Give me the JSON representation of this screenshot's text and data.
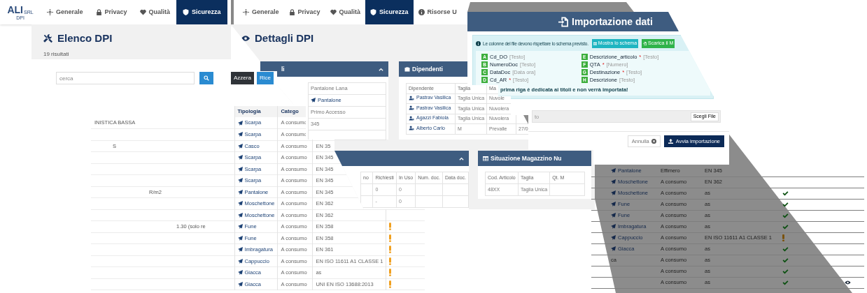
{
  "left_panel": {
    "logo": {
      "text": "ALI",
      "suffix": "SRL",
      "tagline": "DPI"
    },
    "tabs": [
      {
        "label": "Generale",
        "selected": false
      },
      {
        "label": "Privacy",
        "selected": false
      },
      {
        "label": "Qualità",
        "selected": false
      },
      {
        "label": "Sicurezza",
        "selected": true
      }
    ],
    "title": "Elenco DPI",
    "subtitle": "19 risultati",
    "search": {
      "placeholder": "cerca"
    },
    "buttons": [
      {
        "label": "Azzera",
        "kind": "dark"
      },
      {
        "label": "Rice",
        "kind": "primary"
      }
    ],
    "table": {
      "columns": [
        "Tipologia",
        "Catego"
      ],
      "rows": [
        {
          "column_1": "INISTICA BASSA",
          "tipologia": "Scarpa",
          "categoria": "A consumo"
        },
        {
          "tipologia": "Scarpa",
          "categoria": "A consumo"
        },
        {
          "column_1": "S",
          "tipologia": "Casco",
          "categoria": "A consumo",
          "norma": "EN 35"
        },
        {
          "tipologia": "Scarpa",
          "categoria": "A consumo",
          "norma": "EN 345"
        },
        {
          "tipologia": "Scarpa",
          "categoria": "A consumo",
          "norma": "EN 345"
        },
        {
          "tipologia": "Scarpa",
          "categoria": "A consumo",
          "norma": "EN 345"
        },
        {
          "column_1": "R/m2",
          "tipologia": "Pantalone",
          "categoria": "A consumo",
          "norma": "EN 345"
        },
        {
          "tipologia": "Moschettone",
          "categoria": "A consumo",
          "norma": "EN 362"
        },
        {
          "tipologia": "Moschettone",
          "categoria": "A consumo",
          "norma": "EN 362",
          "warning": false
        },
        {
          "column_1": "1.30 (solo re",
          "tipologia": "Fune",
          "categoria": "A consumo",
          "norma": "EN 358",
          "warning": true
        },
        {
          "tipologia": "Fune",
          "categoria": "A consumo",
          "norma": "EN 358",
          "warning": true
        },
        {
          "tipologia": "Imbragatura",
          "categoria": "A consumo",
          "norma": "EN 361",
          "warning": true
        },
        {
          "tipologia": "Cappuccio",
          "categoria": "A consumo",
          "norma": "EN ISO 11611 A1 CLASSE 1",
          "warning": true
        },
        {
          "tipologia": "Giacca",
          "categoria": "A consumo",
          "norma": "as",
          "warning": true
        },
        {
          "tipologia": "Giacca",
          "categoria": "A consumo",
          "norma": "UNI EN ISO 13688:2013",
          "warning": true
        }
      ]
    }
  },
  "middle_panel": {
    "tabs": [
      {
        "label": "Generale",
        "selected": false
      },
      {
        "label": "Privacy",
        "selected": false
      },
      {
        "label": "Qualità",
        "selected": false
      },
      {
        "label": "Sicurezza",
        "selected": true
      },
      {
        "label": "Risorse U",
        "selected": false
      }
    ],
    "title": "Dettagli DPI",
    "details_card": {
      "title": "li",
      "fields": [
        {
          "text": "Pantalone Lana",
          "kind": "text"
        },
        {
          "text": "Pantalone",
          "kind": "link"
        },
        {
          "text": "Primo Accesso",
          "kind": "text"
        },
        {
          "text": "345",
          "kind": "text"
        }
      ]
    },
    "employees_card": {
      "title": "Dipendenti",
      "columns": [
        "Dipendente",
        "Taglia",
        "Ma"
      ],
      "rows": [
        {
          "name": "Pastrav Vasilica",
          "taglia": "Taglia Unica",
          "column_3": "Nuvole"
        },
        {
          "name": "Pastrav Vasilica",
          "taglia": "Taglia Unica",
          "column_3": "Nuvolera"
        },
        {
          "name": "Agazzi Fabiola",
          "taglia": "Taglia Unica",
          "column_3": "Nuvolera"
        },
        {
          "name": "Alberto Carlo",
          "taglia": "M",
          "column_3": "Prevalle",
          "column_4": "27/0"
        }
      ]
    },
    "requests_card": {
      "columns": [
        "no",
        "Richiesti",
        "In Uso",
        "Num. doc.",
        "Data doc."
      ],
      "rows": [
        {
          "richiesti": "0",
          "in_uso": "0"
        },
        {
          "richiesti": "-",
          "in_uso": "0"
        }
      ]
    },
    "stock_card": {
      "title": "Situazione Magazzino Nu",
      "columns": [
        "Cod. Articolo",
        "Taglia",
        "Qt. M"
      ],
      "rows": [
        {
          "cod_articolo": "48XX",
          "taglia": "Taglia Unica"
        }
      ]
    }
  },
  "import_dialog": {
    "title": "Importazione dati",
    "info": "Le colonne del file devono rispettare lo schema previsto.",
    "info_buttons": [
      {
        "label": "Mostra lo schema",
        "kind": "info"
      },
      {
        "label": "Scarica il M",
        "kind": "success"
      }
    ],
    "schema": [
      {
        "letter": "A",
        "name": "Cd_DO",
        "type": "[Testo]"
      },
      {
        "letter": "B",
        "name": "NumeroDoc",
        "type": "[Testo]"
      },
      {
        "letter": "C",
        "name": "DataDoc",
        "type": "[Data ora]"
      },
      {
        "letter": "D",
        "name": "Cd_AR",
        "mark": "*",
        "type": "[Testo]"
      },
      {
        "letter": "E",
        "name": "Descrizione_articolo",
        "mark": "*",
        "type": "[Testo]"
      },
      {
        "letter": "F",
        "name": "QTA",
        "mark": "*",
        "type": "[Numero]"
      },
      {
        "letter": "G",
        "name": "Destinazione",
        "mark": "*",
        "type": "[Testo]"
      },
      {
        "letter": "H",
        "name": "Descrizione",
        "type": "[Testo]"
      }
    ],
    "note": "prima riga è dedicata ai titoli e non verrà importata!",
    "file_input": {
      "value": "to",
      "button": "Scegli File"
    },
    "buttons": [
      {
        "label": "Annulla",
        "kind": "cancel"
      },
      {
        "label": "Avvia importazione",
        "kind": "primary"
      }
    ]
  },
  "background_table": {
    "rows": [
      {
        "tipologia": "Pantalone",
        "link": true,
        "categoria": "Effimero",
        "norma": "EN 345",
        "approved": false,
        "warning": false,
        "viewable": false
      },
      {
        "tipologia": "Moschettone",
        "link": true,
        "categoria": "A consumo",
        "norma": "EN 362",
        "approved": false,
        "warning": false,
        "viewable": false
      },
      {
        "tipologia": "Moschettone",
        "link": true,
        "categoria": "A consumo",
        "norma": "as",
        "approved": true,
        "warning": false,
        "viewable": false
      },
      {
        "tipologia": "Fune",
        "link": true,
        "categoria": "A consumo",
        "norma": "as",
        "approved": true,
        "warning": false,
        "viewable": false
      },
      {
        "tipologia": "Fune",
        "link": true,
        "categoria": "A consumo",
        "norma": "as",
        "approved": true,
        "warning": false,
        "viewable": false
      },
      {
        "tipologia": "Imbragatura",
        "link": true,
        "categoria": "A consumo",
        "norma": "as",
        "approved": true,
        "warning": false,
        "viewable": false
      },
      {
        "tipologia": "Cappuccio",
        "link": true,
        "categoria": "A consumo",
        "norma": "EN ISO 11611 A1 CLASSE 1",
        "approved": false,
        "warning": true,
        "viewable": false
      },
      {
        "tipologia": "Giacca",
        "link": true,
        "categoria": "A consumo",
        "norma": "as",
        "approved": true,
        "warning": false,
        "viewable": false
      },
      {
        "tipologia": "ca",
        "link": false,
        "categoria": "A consumo",
        "norma": "as",
        "approved": true,
        "warning": false,
        "viewable": false
      },
      {
        "categoria": "A consumo",
        "norma": "as",
        "approved": true,
        "warning": false,
        "viewable": false
      },
      {
        "categoria": "A consumo",
        "norma": "as",
        "approved": true,
        "warning": false,
        "viewable": true
      }
    ]
  }
}
